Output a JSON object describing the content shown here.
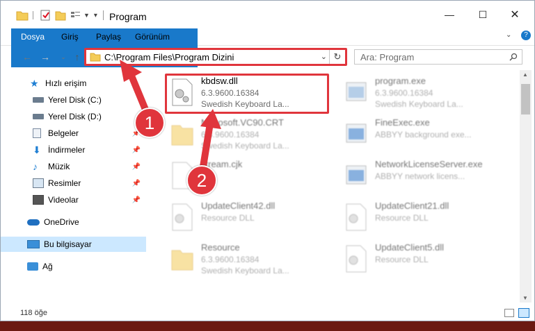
{
  "window": {
    "title": "Program"
  },
  "ribbon": {
    "tabs": [
      "Dosya",
      "Giriş",
      "Paylaş",
      "Görünüm"
    ]
  },
  "address": {
    "path": "C:\\Program Files\\Program Dizini"
  },
  "search": {
    "placeholder": "Ara: Program"
  },
  "sidebar": {
    "items": [
      {
        "label": "Hızlı erişim",
        "icon": "star-icon"
      },
      {
        "label": "Yerel Disk (C:)",
        "icon": "drive-icon"
      },
      {
        "label": "Yerel Disk (D:)",
        "icon": "drive-icon"
      },
      {
        "label": "Belgeler",
        "icon": "documents-icon"
      },
      {
        "label": "İndirmeler",
        "icon": "download-icon"
      },
      {
        "label": "Müzik",
        "icon": "music-icon"
      },
      {
        "label": "Resimler",
        "icon": "pictures-icon"
      },
      {
        "label": "Videolar",
        "icon": "videos-icon"
      },
      {
        "label": "OneDrive",
        "icon": "cloud-icon"
      },
      {
        "label": "Bu bilgisayar",
        "icon": "computer-icon"
      },
      {
        "label": "Ağ",
        "icon": "network-icon"
      }
    ]
  },
  "files": [
    {
      "name": "kbdsw.dll",
      "line2": "6.3.9600.16384",
      "line3": "Swedish Keyboard La..."
    },
    {
      "name": "Microsoft.VC90.CRT",
      "line2": "6.3.9600.16384",
      "line3": "Swedish Keyboard La..."
    },
    {
      "name": "stream.cjk",
      "line2": "",
      "line3": ""
    },
    {
      "name": "UpdateClient42.dll",
      "line2": "Resource DLL",
      "line3": ""
    },
    {
      "name": "Resource",
      "line2": "6.3.9600.16384",
      "line3": "Swedish Keyboard La..."
    },
    {
      "name": "program.exe",
      "line2": "6.3.9600.16384",
      "line3": "Swedish Keyboard La..."
    },
    {
      "name": "FineExec.exe",
      "line2": "ABBYY background exe...",
      "line3": ""
    },
    {
      "name": "NetworkLicenseServer.exe",
      "line2": "ABBYY network licens...",
      "line3": ""
    },
    {
      "name": "UpdateClient21.dll",
      "line2": "Resource DLL",
      "line3": ""
    },
    {
      "name": "UpdateClient5.dll",
      "line2": "Resource DLL",
      "line3": ""
    }
  ],
  "status": {
    "count": "118 öğe"
  },
  "annotations": {
    "step1": "1",
    "step2": "2"
  },
  "colors": {
    "accent": "#1979ca",
    "highlight": "#e0353c",
    "selection": "#cce8ff"
  }
}
